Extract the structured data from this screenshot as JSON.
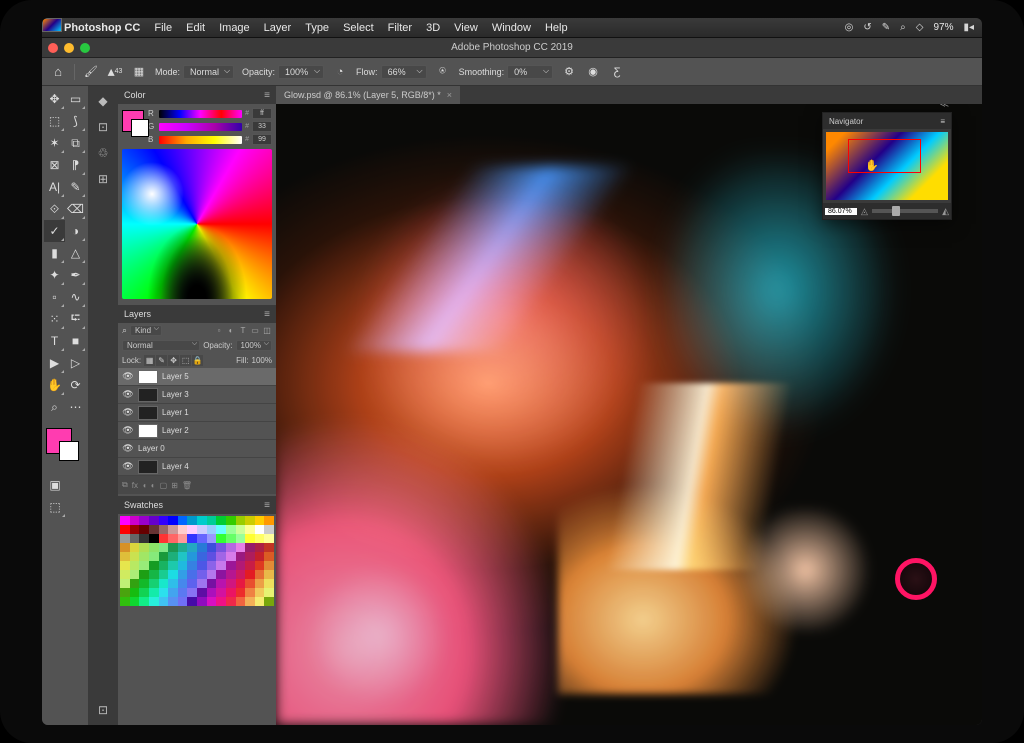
{
  "menubar": {
    "app": "Photoshop CC",
    "items": [
      "File",
      "Edit",
      "Image",
      "Layer",
      "Type",
      "Select",
      "Filter",
      "3D",
      "View",
      "Window",
      "Help"
    ],
    "battery": "97%"
  },
  "window_title": "Adobe Photoshop CC 2019",
  "optionsbar": {
    "brush_size": "43",
    "mode_label": "Mode:",
    "mode_value": "Normal",
    "opacity_label": "Opacity:",
    "opacity_value": "100%",
    "flow_label": "Flow:",
    "flow_value": "66%",
    "smoothing_label": "Smoothing:",
    "smoothing_value": "0%"
  },
  "document_tab": "Glow.psd @ 86.1% (Layer 5, RGB/8*) *",
  "panels": {
    "color": {
      "title": "Color",
      "r": "ff",
      "g": "33",
      "b": "99"
    },
    "layers": {
      "title": "Layers",
      "kind": "Kind",
      "blend": "Normal",
      "opacity_label": "Opacity:",
      "opacity_value": "100%",
      "lock_label": "Lock:",
      "fill_label": "Fill:",
      "fill_value": "100%",
      "items": [
        {
          "name": "Layer 5",
          "selected": true,
          "thumb": "white"
        },
        {
          "name": "Layer 3",
          "selected": false,
          "thumb": "dark"
        },
        {
          "name": "Layer 1",
          "selected": false,
          "thumb": "dark"
        },
        {
          "name": "Layer 2",
          "selected": false,
          "thumb": "white"
        },
        {
          "name": "Layer 0",
          "selected": false,
          "thumb": "art"
        },
        {
          "name": "Layer 4",
          "selected": false,
          "thumb": "dark"
        }
      ]
    },
    "swatches": {
      "title": "Swatches"
    }
  },
  "navigator": {
    "title": "Navigator",
    "zoom": "86.07%"
  }
}
